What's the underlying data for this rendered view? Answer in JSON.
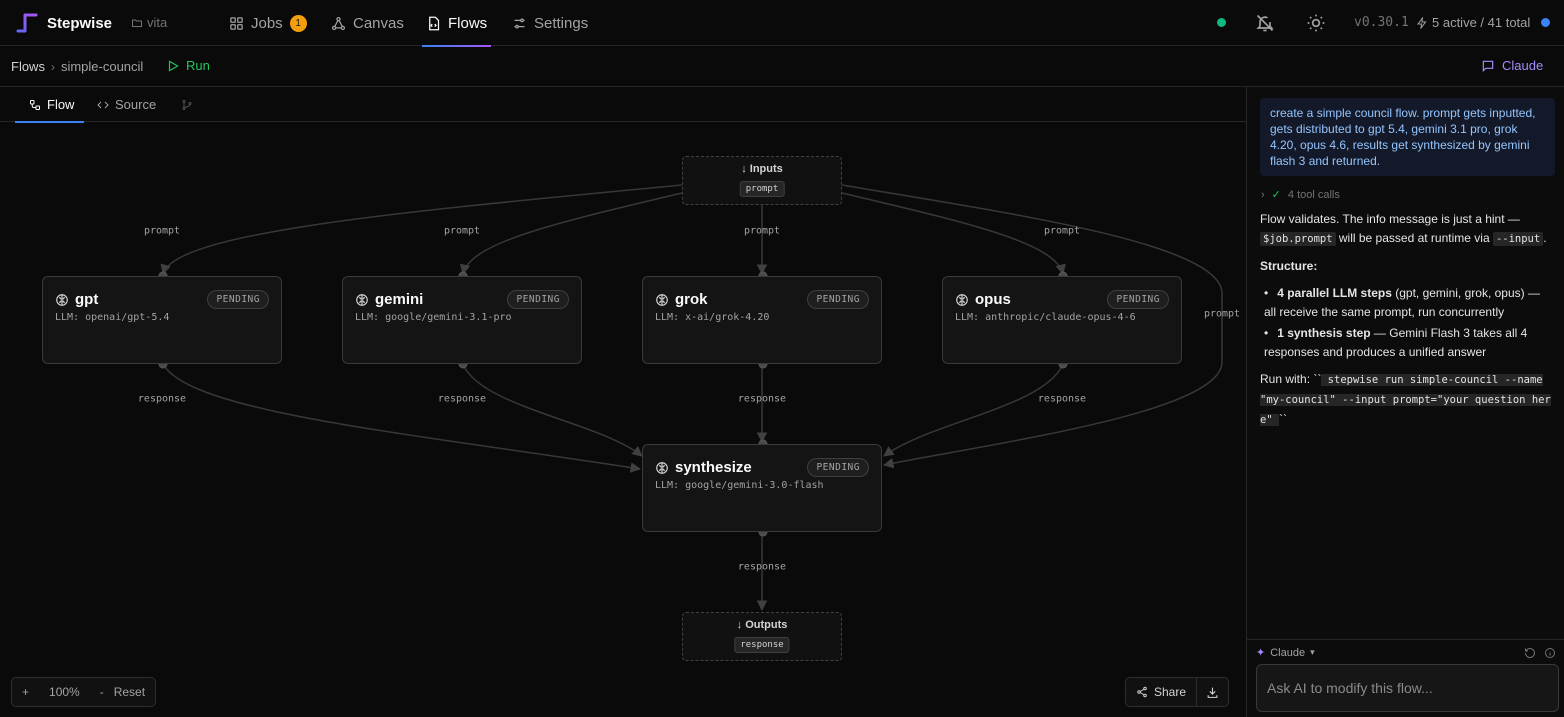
{
  "app": {
    "name": "Stepwise",
    "workspace": "vita",
    "version": "v0.30.1",
    "active_summary": "5 active / 41 total"
  },
  "nav": [
    {
      "label": "Jobs",
      "badge": "1"
    },
    {
      "label": "Canvas"
    },
    {
      "label": "Flows"
    },
    {
      "label": "Settings"
    }
  ],
  "breadcrumb": {
    "root": "Flows",
    "current": "simple-council"
  },
  "toolbar": {
    "run_label": "Run",
    "claude_label": "Claude"
  },
  "tabs": [
    {
      "label": "Flow"
    },
    {
      "label": "Source"
    }
  ],
  "flow": {
    "inputs": {
      "title": "Inputs",
      "field": "prompt"
    },
    "outputs": {
      "title": "Outputs",
      "field": "response"
    },
    "edge_labels": {
      "prompt": "prompt",
      "response": "response"
    },
    "nodes": [
      {
        "name": "gpt",
        "model": "LLM: openai/gpt-5.4",
        "status": "PENDING"
      },
      {
        "name": "gemini",
        "model": "LLM: google/gemini-3.1-pro",
        "status": "PENDING"
      },
      {
        "name": "grok",
        "model": "LLM: x-ai/grok-4.20",
        "status": "PENDING"
      },
      {
        "name": "opus",
        "model": "LLM: anthropic/claude-opus-4-6",
        "status": "PENDING"
      },
      {
        "name": "synthesize",
        "model": "LLM: google/gemini-3.0-flash",
        "status": "PENDING"
      }
    ]
  },
  "zoom": {
    "plus": "+",
    "level": "100%",
    "minus": "-",
    "reset": "Reset"
  },
  "share_label": "Share",
  "chat": {
    "user_message": "create a simple council flow. prompt gets inputted, gets distributed to gpt 5.4, gemini 3.1 pro, grok 4.20, opus 4.6, results get synthesized by gemini flash 3 and returned.",
    "tool_calls": "4 tool calls",
    "p1_a": "Flow validates. The info message is just a hint — ",
    "p1_code1": "$job.prompt",
    "p1_b": " will be passed at runtime via ",
    "p1_code2": "--input",
    "p1_c": ".",
    "structure_heading": "Structure:",
    "b1_bold": "4 parallel LLM steps",
    "b1_rest": " (gpt, gemini, grok, opus) — all receive the same prompt, run concurrently",
    "b2_bold": "1 synthesis step",
    "b2_rest": " — Gemini Flash 3 takes all 4 responses and produces a unified answer",
    "run_with": "Run with: ``",
    "run_cmd": " stepwise run simple-council --name \"my-council\" --input prompt=\"your question here\" ",
    "run_end": "``",
    "model": "Claude",
    "input_placeholder": "Ask AI to modify this flow..."
  },
  "colors": {
    "accent_blue": "#3b82f6",
    "run_green": "#22c55e",
    "claude_purple": "#a78bfa",
    "badge_amber": "#f59e0b",
    "status_green": "#10b981"
  }
}
